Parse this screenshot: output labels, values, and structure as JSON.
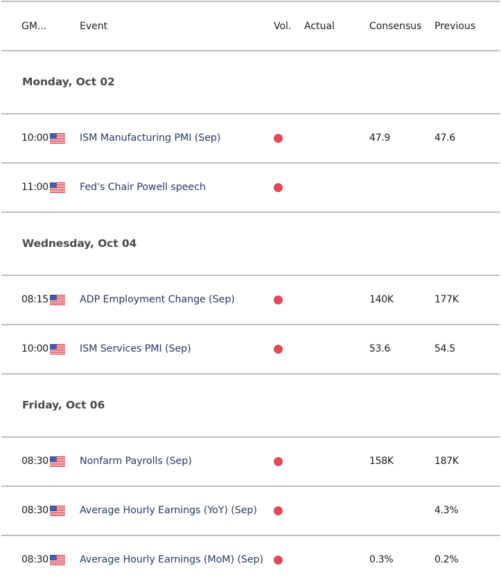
{
  "columns": {
    "time": "GM...",
    "event": "Event",
    "vol": "Vol.",
    "actual": "Actual",
    "consensus": "Consensus",
    "previous": "Previous"
  },
  "colors": {
    "volatility_high": "#e04a55",
    "divider": "#b9bfbf"
  },
  "days": [
    {
      "date": "Monday, Oct 02",
      "events": [
        {
          "time": "10:00",
          "country_icon": "us-flag-icon",
          "event": "ISM Manufacturing PMI (Sep)",
          "volatility": "high",
          "actual": "",
          "consensus": "47.9",
          "previous": "47.6"
        },
        {
          "time": "11:00",
          "country_icon": "us-flag-icon",
          "event": "Fed's Chair Powell speech",
          "volatility": "high",
          "actual": "",
          "consensus": "",
          "previous": ""
        }
      ]
    },
    {
      "date": "Wednesday, Oct 04",
      "events": [
        {
          "time": "08:15",
          "country_icon": "us-flag-icon",
          "event": "ADP Employment Change (Sep)",
          "volatility": "high",
          "actual": "",
          "consensus": "140K",
          "previous": "177K"
        },
        {
          "time": "10:00",
          "country_icon": "us-flag-icon",
          "event": "ISM Services PMI (Sep)",
          "volatility": "high",
          "actual": "",
          "consensus": "53.6",
          "previous": "54.5"
        }
      ]
    },
    {
      "date": "Friday, Oct 06",
      "events": [
        {
          "time": "08:30",
          "country_icon": "us-flag-icon",
          "event": "Nonfarm Payrolls (Sep)",
          "volatility": "high",
          "actual": "",
          "consensus": "158K",
          "previous": "187K"
        },
        {
          "time": "08:30",
          "country_icon": "us-flag-icon",
          "event": "Average Hourly Earnings (YoY) (Sep)",
          "volatility": "high",
          "actual": "",
          "consensus": "",
          "previous": "4.3%"
        },
        {
          "time": "08:30",
          "country_icon": "us-flag-icon",
          "event": "Average Hourly Earnings (MoM) (Sep)",
          "volatility": "high",
          "actual": "",
          "consensus": "0.3%",
          "previous": "0.2%"
        }
      ]
    }
  ]
}
